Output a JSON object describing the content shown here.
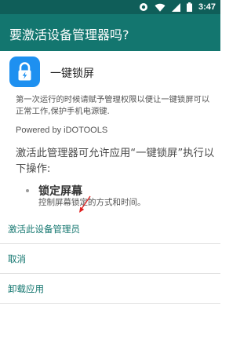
{
  "status_bar": {
    "time": "3:47",
    "icons": [
      "notification-circle-icon",
      "wifi-icon",
      "cell-signal-icon",
      "battery-icon"
    ]
  },
  "app_bar": {
    "title": "要激活设备管理器吗?"
  },
  "app": {
    "name": "一键锁屏",
    "icon": "lock-icon",
    "icon_color": "#1E90F0",
    "description": "第一次运行的时候请赋予管理权限以便让一键锁屏可以正常工作,保护手机电源键.",
    "powered_by": "Powered by iDOTOOLS"
  },
  "permissions": {
    "intro": "激活此管理器可允许应用“一键锁屏”执行以下操作:",
    "items": [
      {
        "title": "锁定屏幕",
        "description": "控制屏幕锁定的方式和时间。"
      }
    ]
  },
  "actions": [
    {
      "label": "激活此设备管理员"
    },
    {
      "label": "取消"
    },
    {
      "label": "卸载应用"
    }
  ],
  "colors": {
    "status_bar": "#0F5E59",
    "app_bar": "#13766F",
    "action_text": "#13766F",
    "annotation_arrow": "#E02020"
  }
}
